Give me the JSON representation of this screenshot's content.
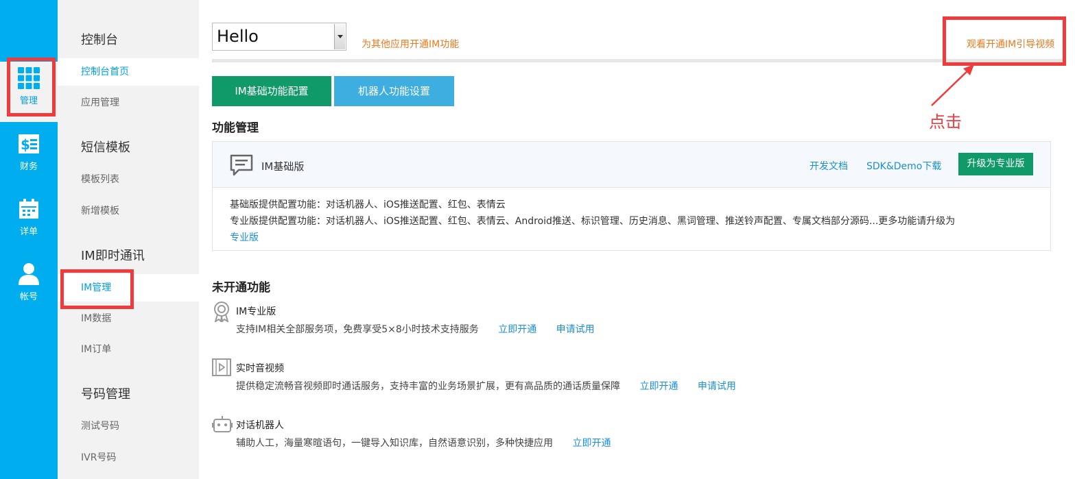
{
  "rail": {
    "items": [
      {
        "label": "管理",
        "icon": "grid-icon"
      },
      {
        "label": "财务",
        "icon": "finance-icon"
      },
      {
        "label": "详单",
        "icon": "calendar-icon"
      },
      {
        "label": "帐号",
        "icon": "user-icon"
      }
    ]
  },
  "sidebar": {
    "groups": [
      {
        "title": "控制台",
        "items": [
          "控制台首页",
          "应用管理"
        ]
      },
      {
        "title": "短信模板",
        "items": [
          "模板列表",
          "新增模板"
        ]
      },
      {
        "title": "IM即时通讯",
        "items": [
          "IM管理",
          "IM数据",
          "IM订单"
        ]
      },
      {
        "title": "号码管理",
        "items": [
          "测试号码",
          "IVR号码"
        ]
      }
    ]
  },
  "header": {
    "app_select_value": "Hello",
    "enable_for_other_apps": "为其他应用开通IM功能",
    "watch_video": "观看开通IM引导视频"
  },
  "tabs": [
    "IM基础功能配置",
    "机器人功能设置"
  ],
  "feature_mgmt": {
    "title": "功能管理",
    "card": {
      "name": "IM基础版",
      "dev_docs": "开发文档",
      "sdk_download": "SDK&Demo下载",
      "upgrade_button": "升级为专业版",
      "line1": "基础版提供配置功能：对话机器人、iOS推送配置、红包、表情云",
      "line2": "专业版提供配置功能：对话机器人、iOS推送配置、红包、表情云、Android推送、标识管理、历史消息、黑词管理、推送铃声配置、专属文档部分源码...更多功能请升级为",
      "line3_link": "专业版"
    }
  },
  "inactive": {
    "title": "未开通功能",
    "items": [
      {
        "name": "IM专业版",
        "desc": "支持IM相关全部服务项，免费享受5×8小时技术支持服务",
        "actions": [
          "立即开通",
          "申请试用"
        ],
        "icon": "medal-icon"
      },
      {
        "name": "实时音视频",
        "desc": "提供稳定流畅音视频即时通话服务，支持丰富的业务场景扩展，更有高品质的通话质量保障",
        "actions": [
          "立即开通",
          "申请试用"
        ],
        "icon": "video-icon"
      },
      {
        "name": "对话机器人",
        "desc": "辅助人工，海量寒暄语句，一键导入知识库，自然语意识别，多种快捷应用",
        "actions": [
          "立即开通"
        ],
        "icon": "robot-icon"
      }
    ]
  },
  "annotation": {
    "click_text": "点击",
    "color": "#ef3b3b"
  },
  "colors": {
    "rail_blue": "#00aeef",
    "green": "#109a6a",
    "tab_blue": "#3daedf",
    "link_blue": "#1a8fd4",
    "orange": "#e87a1e"
  }
}
